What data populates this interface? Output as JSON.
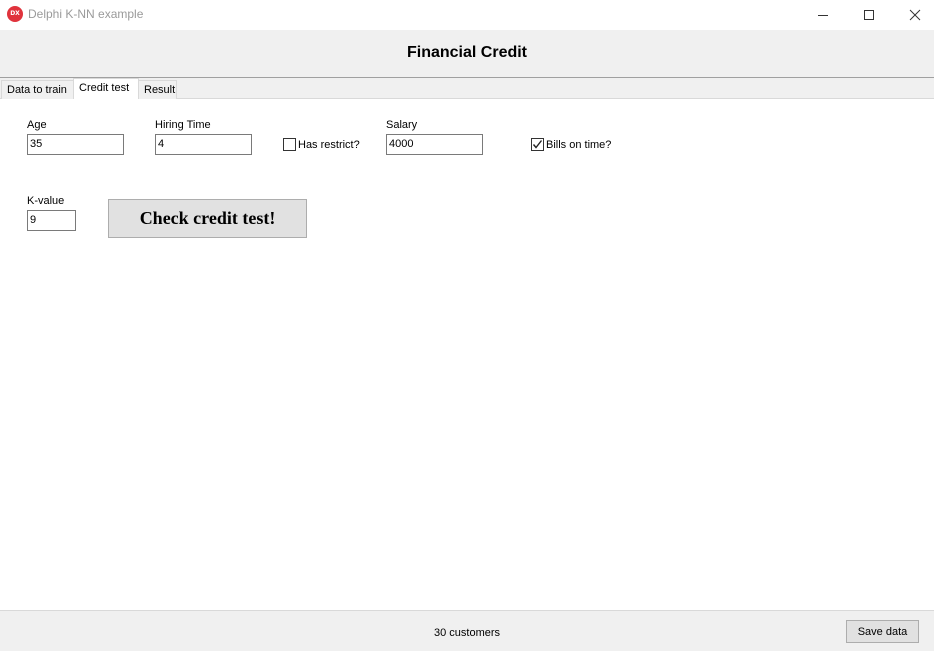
{
  "window": {
    "app_icon_text": "DX",
    "title": "Delphi K-NN example"
  },
  "header": {
    "title": "Financial Credit"
  },
  "tabs": [
    {
      "label": "Data to train",
      "active": false
    },
    {
      "label": "Credit test",
      "active": true
    },
    {
      "label": "Result",
      "active": false
    }
  ],
  "form": {
    "age": {
      "label": "Age",
      "value": "35"
    },
    "hiring_time": {
      "label": "Hiring Time",
      "value": "4"
    },
    "has_restrict": {
      "label": "Has restrict?",
      "checked": false
    },
    "salary": {
      "label": "Salary",
      "value": "4000"
    },
    "bills_on_time": {
      "label": "Bills on time?",
      "checked": true
    },
    "k_value": {
      "label": "K-value",
      "value": "9"
    },
    "check_button_label": "Check credit test!"
  },
  "status": {
    "text": "30 customers",
    "save_label": "Save data"
  },
  "icons": {
    "minimize": "minimize-icon",
    "maximize": "maximize-icon",
    "close": "close-icon",
    "checkmark": "checkmark-icon"
  }
}
